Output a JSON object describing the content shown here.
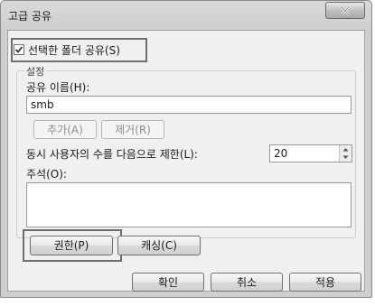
{
  "window": {
    "title": "고급 공유"
  },
  "share": {
    "checkbox_label": "선택한 폴더 공유(S)",
    "checked": true
  },
  "settings": {
    "group_label": "설정",
    "share_name_label": "공유 이름(H):",
    "share_name_value": "smb",
    "add_button": "추가(A)",
    "remove_button": "제거(R)",
    "limit_label": "동시 사용자의 수를 다음으로 제한(L):",
    "limit_value": "20",
    "comment_label": "주석(O):",
    "comment_value": "",
    "permissions_button": "권한(P)",
    "caching_button": "캐싱(C)"
  },
  "footer": {
    "ok_button": "확인",
    "cancel_button": "취소",
    "apply_button": "적용"
  },
  "icons": {
    "close": "close-icon",
    "check": "checkmark-icon",
    "spin_up": "spin-up-icon",
    "spin_down": "spin-down-icon"
  }
}
